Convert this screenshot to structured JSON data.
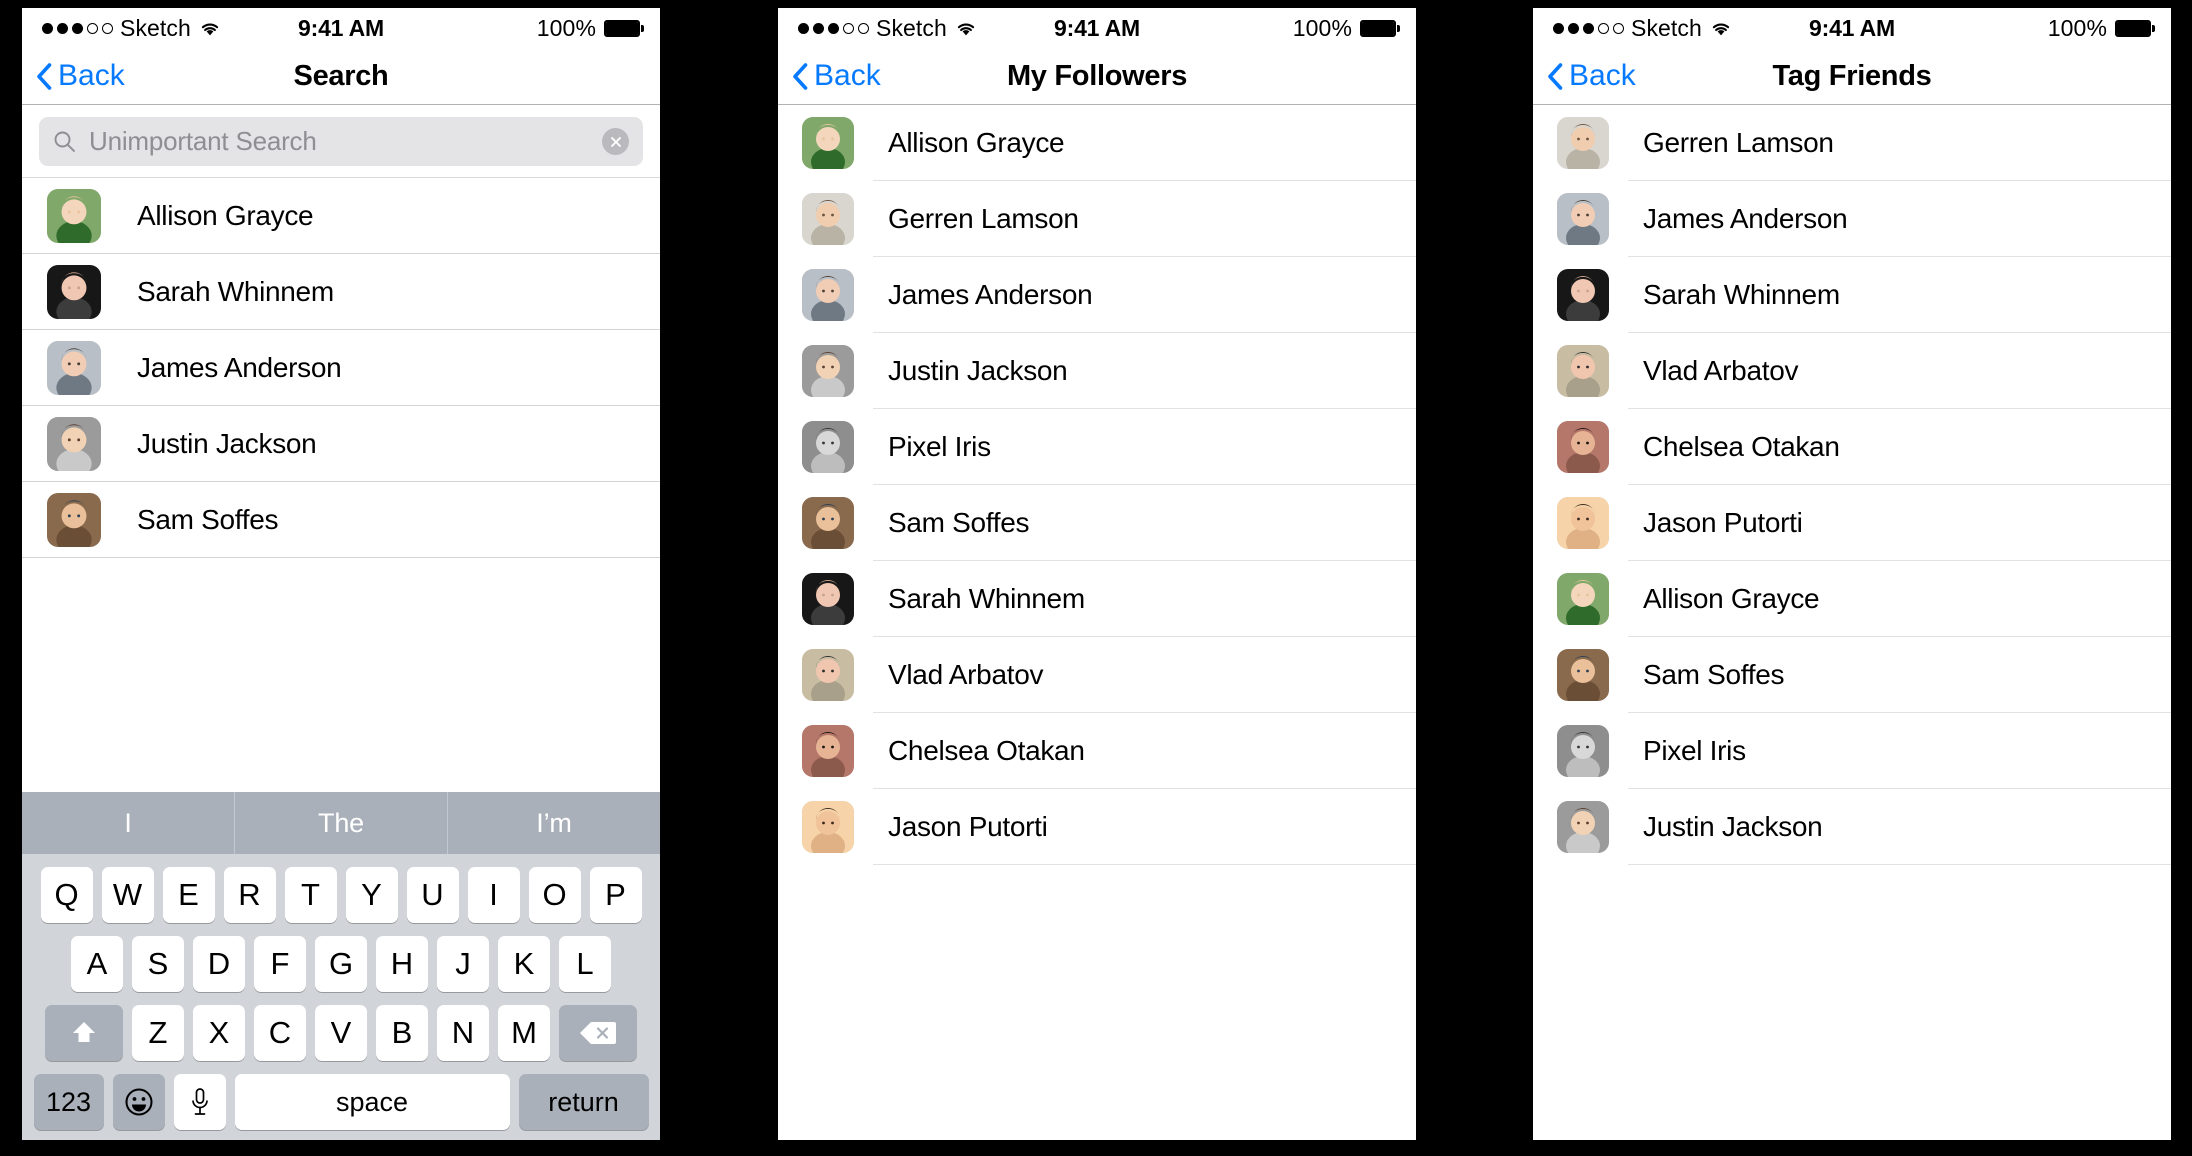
{
  "status_bar": {
    "carrier": "Sketch",
    "time": "9:41 AM",
    "battery_percent": "100%",
    "signal_dots_filled": 3,
    "signal_dots_total": 5,
    "wifi_icon": "wifi-icon",
    "battery_icon": "battery-full-icon"
  },
  "panel1": {
    "nav": {
      "back_label": "Back",
      "back_icon": "chevron-left-icon",
      "title": "Search"
    },
    "search": {
      "placeholder": "Unimportant Search",
      "value": "",
      "search_icon": "search-icon",
      "clear_icon": "clear-circle-icon"
    },
    "list": [
      {
        "name": "Allison Grayce",
        "avatar": "avatar-allison-grayce"
      },
      {
        "name": "Sarah Whinnem",
        "avatar": "avatar-sarah-whinnem"
      },
      {
        "name": "James Anderson",
        "avatar": "avatar-james-anderson"
      },
      {
        "name": "Justin Jackson",
        "avatar": "avatar-justin-jackson"
      },
      {
        "name": "Sam Soffes",
        "avatar": "avatar-sam-soffes"
      }
    ],
    "keyboard": {
      "predictions": [
        "I",
        "The",
        "I’m"
      ],
      "row1": [
        "Q",
        "W",
        "E",
        "R",
        "T",
        "Y",
        "U",
        "I",
        "O",
        "P"
      ],
      "row2": [
        "A",
        "S",
        "D",
        "F",
        "G",
        "H",
        "J",
        "K",
        "L"
      ],
      "row3": [
        "Z",
        "X",
        "C",
        "V",
        "B",
        "N",
        "M"
      ],
      "shift_icon": "shift-up-arrow-icon",
      "delete_icon": "backspace-delete-icon",
      "numbers_label": "123",
      "emoji_icon": "emoji-smiley-icon",
      "mic_icon": "microphone-icon",
      "space_label": "space",
      "return_label": "return"
    }
  },
  "panel2": {
    "nav": {
      "back_label": "Back",
      "back_icon": "chevron-left-icon",
      "title": "My Followers"
    },
    "list": [
      {
        "name": "Allison Grayce",
        "avatar": "avatar-allison-grayce"
      },
      {
        "name": "Gerren Lamson",
        "avatar": "avatar-gerren-lamson"
      },
      {
        "name": "James Anderson",
        "avatar": "avatar-james-anderson"
      },
      {
        "name": "Justin Jackson",
        "avatar": "avatar-justin-jackson"
      },
      {
        "name": "Pixel Iris",
        "avatar": "avatar-pixel-iris"
      },
      {
        "name": "Sam Soffes",
        "avatar": "avatar-sam-soffes"
      },
      {
        "name": "Sarah Whinnem",
        "avatar": "avatar-sarah-whinnem"
      },
      {
        "name": "Vlad Arbatov",
        "avatar": "avatar-vlad-arbatov"
      },
      {
        "name": "Chelsea Otakan",
        "avatar": "avatar-chelsea-otakan"
      },
      {
        "name": "Jason Putorti",
        "avatar": "avatar-jason-putorti"
      }
    ]
  },
  "panel3": {
    "nav": {
      "back_label": "Back",
      "back_icon": "chevron-left-icon",
      "title": "Tag Friends"
    },
    "list": [
      {
        "name": "Gerren Lamson",
        "avatar": "avatar-gerren-lamson"
      },
      {
        "name": "James Anderson",
        "avatar": "avatar-james-anderson"
      },
      {
        "name": "Sarah Whinnem",
        "avatar": "avatar-sarah-whinnem"
      },
      {
        "name": "Vlad Arbatov",
        "avatar": "avatar-vlad-arbatov"
      },
      {
        "name": "Chelsea Otakan",
        "avatar": "avatar-chelsea-otakan"
      },
      {
        "name": "Jason Putorti",
        "avatar": "avatar-jason-putorti"
      },
      {
        "name": "Allison Grayce",
        "avatar": "avatar-allison-grayce"
      },
      {
        "name": "Sam Soffes",
        "avatar": "avatar-sam-soffes"
      },
      {
        "name": "Pixel Iris",
        "avatar": "avatar-pixel-iris"
      },
      {
        "name": "Justin Jackson",
        "avatar": "avatar-justin-jackson"
      }
    ]
  },
  "colors": {
    "accent_blue": "#067aff",
    "separator": "#d4d4d4",
    "search_field_bg": "#e4e4e6",
    "keyboard_bg": "#d1d5da",
    "predictive_bg": "#aab0b9",
    "key_dark": "#a9b0ba",
    "placeholder_text": "#8e8e93"
  }
}
